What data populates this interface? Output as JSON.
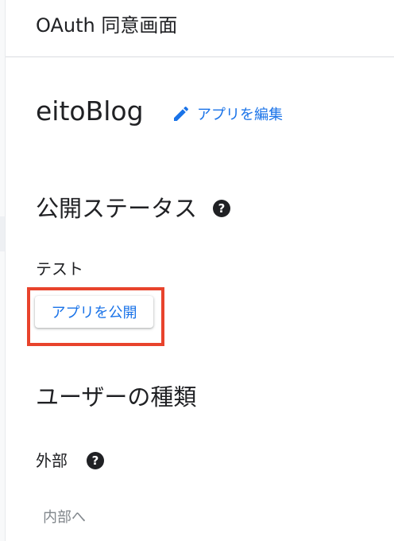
{
  "header": {
    "title": "OAuth 同意画面"
  },
  "app": {
    "name": "eitoBlog",
    "edit_link_label": "アプリを編集",
    "edit_icon": "pencil-icon"
  },
  "publishing_status": {
    "title": "公開ステータス",
    "help_icon": "help-circle-icon",
    "status": "テスト",
    "publish_button_label": "アプリを公開"
  },
  "user_type": {
    "title": "ユーザーの種類",
    "value": "外部",
    "help_icon": "help-circle-icon",
    "switch_button_label": "内部へ"
  },
  "colors": {
    "accent": "#1a73e8",
    "highlight": "#e8432c",
    "text": "#202124",
    "muted": "#80868b"
  }
}
